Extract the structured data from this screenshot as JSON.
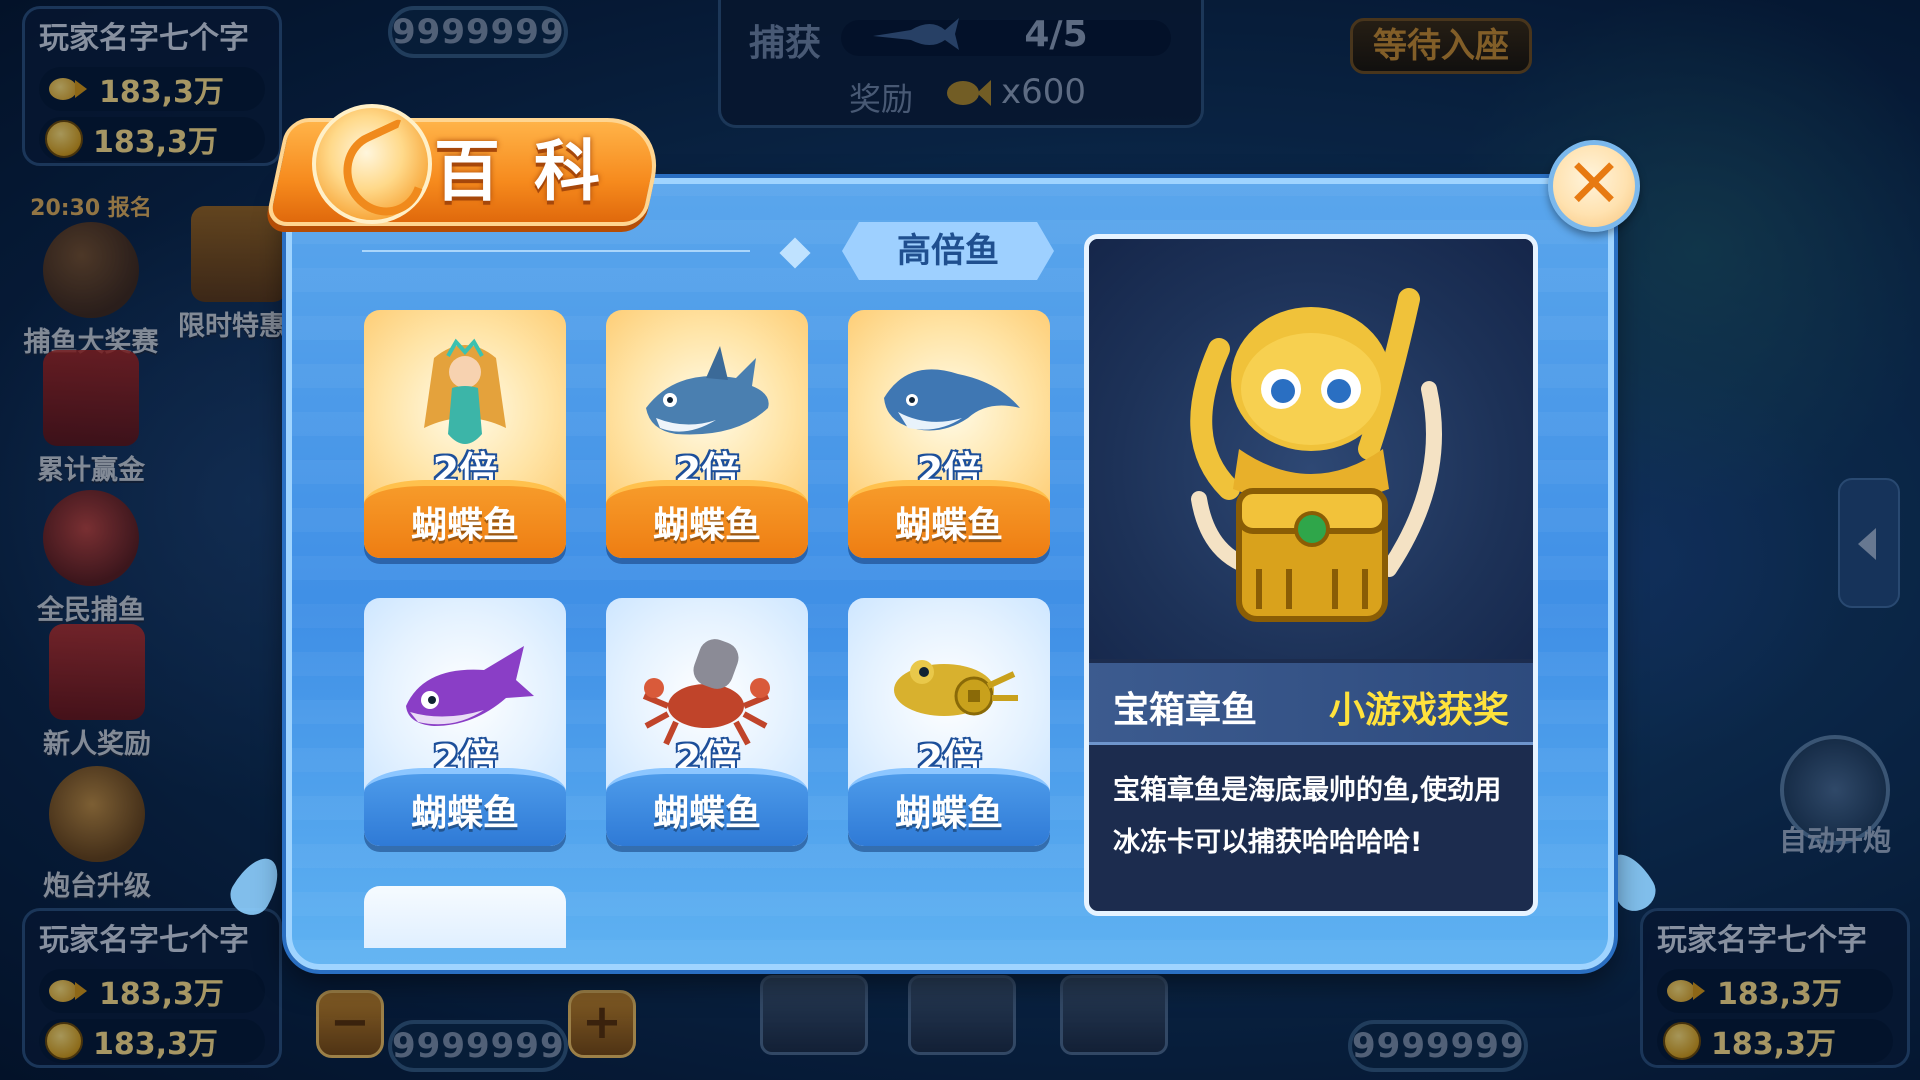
{
  "hud": {
    "top_left": {
      "name": "玩家名字七个字",
      "fish_score": "183,3万",
      "coins": "183,3万"
    },
    "bottom_left": {
      "name": "玩家名字七个字",
      "fish_score": "183,3万",
      "coins": "183,3万"
    },
    "bottom_right": {
      "name": "玩家名字七个字",
      "fish_score": "183,3万",
      "coins": "183,3万"
    },
    "top_score": "9999999",
    "bottom_left_score": "9999999",
    "bottom_right_score": "9999999",
    "capture": {
      "label": "捕获",
      "count": "4/5",
      "reward_label": "奖励",
      "reward_value": "x600"
    },
    "wait_button": "等待入座",
    "auto_fire": "自动开炮",
    "cannon_minus": "−",
    "cannon_plus": "+"
  },
  "side_menu": [
    {
      "label": "捕鱼大奖赛",
      "tag": "20:30 报名",
      "icon": "trophy-icon"
    },
    {
      "label": "限时特惠",
      "icon": "treasure-chest-icon"
    },
    {
      "label": "累计赢金",
      "icon": "red-envelope-icon"
    },
    {
      "label": "全民捕鱼",
      "icon": "lucky-cat-icon"
    },
    {
      "label": "新人奖励",
      "icon": "gift-box-icon"
    },
    {
      "label": "炮台升级",
      "icon": "cannon-icon"
    }
  ],
  "modal": {
    "title": "百科",
    "close_label": "✕",
    "category_tab": "高倍鱼",
    "fish": [
      {
        "name": "蝴蝶鱼",
        "multiplier": "2倍",
        "style": "gold",
        "art": "mermaid"
      },
      {
        "name": "蝴蝶鱼",
        "multiplier": "2倍",
        "style": "gold",
        "art": "shark"
      },
      {
        "name": "蝴蝶鱼",
        "multiplier": "2倍",
        "style": "gold",
        "art": "manta-ray"
      },
      {
        "name": "蝴蝶鱼",
        "multiplier": "2倍",
        "style": "blue",
        "art": "purple-fish"
      },
      {
        "name": "蝴蝶鱼",
        "multiplier": "2倍",
        "style": "blue",
        "art": "cannon-crab"
      },
      {
        "name": "蝴蝶鱼",
        "multiplier": "2倍",
        "style": "blue",
        "art": "golden-toad"
      }
    ],
    "detail": {
      "name": "宝箱章鱼",
      "tag": "小游戏获奖",
      "description": "宝箱章鱼是海底最帅的鱼,使劲用冰冻卡可以捕获哈哈哈哈!"
    }
  },
  "colors": {
    "accent_orange": "#f68a1d",
    "modal_blue": "#3f8fe6",
    "tag_yellow": "#ffe23c"
  }
}
